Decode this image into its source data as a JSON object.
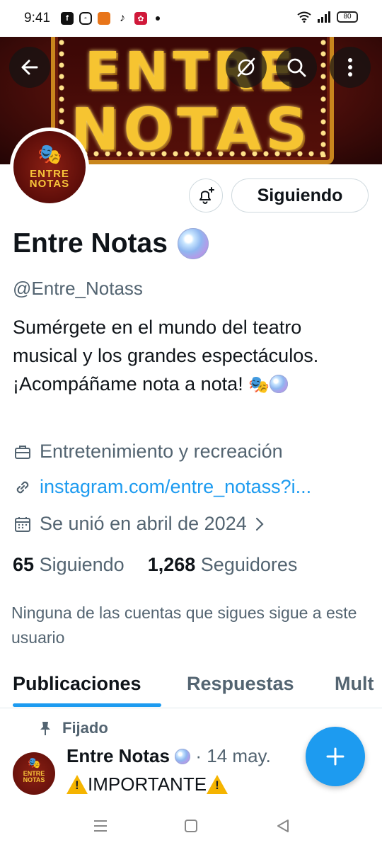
{
  "status_bar": {
    "time": "9:41",
    "battery": "80",
    "apps": [
      {
        "icon": "facebook-icon",
        "glyph": "f",
        "color": "#111111"
      },
      {
        "icon": "instagram-icon",
        "glyph": "◎",
        "color": "#111111"
      },
      {
        "icon": "radio-app-icon",
        "glyph": "▪",
        "color": "#e8751a"
      },
      {
        "icon": "tiktok-icon",
        "glyph": "♪",
        "color": "#111111"
      },
      {
        "icon": "app-icon",
        "glyph": "✿",
        "color": "#d0193a"
      }
    ]
  },
  "banner": {
    "line1": "ENTRE",
    "line2": "NOTAS"
  },
  "profile": {
    "avatar_text": "ENTRE NOTAS",
    "display_name": "Entre Notas",
    "handle": "@Entre_Notass",
    "bio": "Sumérgete en el mundo del teatro musical y los grandes espectáculos. ¡Acompáñame nota a nota!",
    "follow_button": "Siguiendo",
    "category": "Entretenimiento y recreación",
    "link": "instagram.com/entre_notass?i...",
    "joined": "Se unió en abril de 2024",
    "following_count": "65",
    "following_label": "Siguiendo",
    "followers_count": "1,268",
    "followers_label": "Seguidores",
    "mutuals_note": "Ninguna de las cuentas que sigues sigue a este usuario"
  },
  "tabs": [
    {
      "label": "Publicaciones",
      "active": true
    },
    {
      "label": "Respuestas",
      "active": false
    },
    {
      "label": "Mult",
      "active": false
    }
  ],
  "post": {
    "pinned_label": "Fijado",
    "author": "Entre Notas",
    "date": "· 14 may.",
    "text": "IMPORTANTE"
  },
  "colors": {
    "accent": "#1d9bf0",
    "text": "#0f1419",
    "secondary": "#536471",
    "banner_gold": "#f6c431"
  }
}
